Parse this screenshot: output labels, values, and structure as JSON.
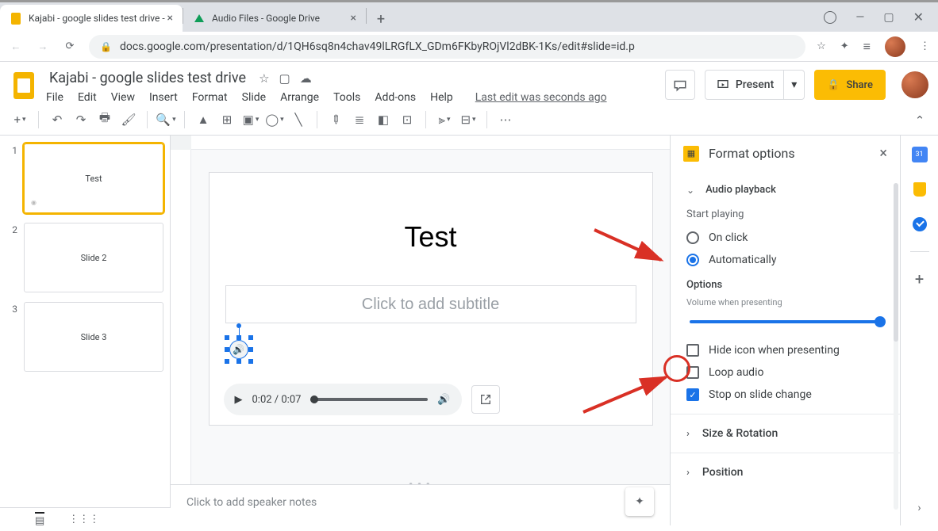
{
  "browser": {
    "tabs": [
      {
        "title": "Kajabi - google slides test drive - ",
        "active": true
      },
      {
        "title": "Audio Files - Google Drive",
        "active": false
      }
    ],
    "url_display": "docs.google.com/presentation/d/1QH6sq8n4chav49lLRGfLX_GDm6FKbyROjVl2dBK-1Ks/edit#slide=id.p"
  },
  "doc": {
    "title": "Kajabi - google slides test drive",
    "menus": [
      "File",
      "Edit",
      "View",
      "Insert",
      "Format",
      "Slide",
      "Arrange",
      "Tools",
      "Add-ons",
      "Help"
    ],
    "last_edit": "Last edit was seconds ago",
    "present": "Present",
    "share": "Share"
  },
  "slides": [
    {
      "num": "1",
      "label": "Test",
      "selected": true,
      "has_audio": true
    },
    {
      "num": "2",
      "label": "Slide 2",
      "selected": false,
      "has_audio": false
    },
    {
      "num": "3",
      "label": "Slide 3",
      "selected": false,
      "has_audio": false
    }
  ],
  "canvas": {
    "title_text": "Test",
    "subtitle_placeholder": "Click to add subtitle",
    "audio_time": "0:02 / 0:07"
  },
  "notes_placeholder": "Click to add speaker notes",
  "panel": {
    "title": "Format options",
    "section_audio": "Audio playback",
    "start_playing_label": "Start playing",
    "radio_onclick": "On click",
    "radio_auto": "Automatically",
    "options_label": "Options",
    "volume_label": "Volume when presenting",
    "hide_icon": "Hide icon when presenting",
    "loop_audio": "Loop audio",
    "stop_change": "Stop on slide change",
    "size_rotation": "Size & Rotation",
    "position": "Position",
    "playback_state": {
      "start_playing": "Automatically",
      "hide_icon_checked": false,
      "loop_audio_checked": false,
      "stop_on_change_checked": true
    }
  },
  "calendar_day": "31"
}
